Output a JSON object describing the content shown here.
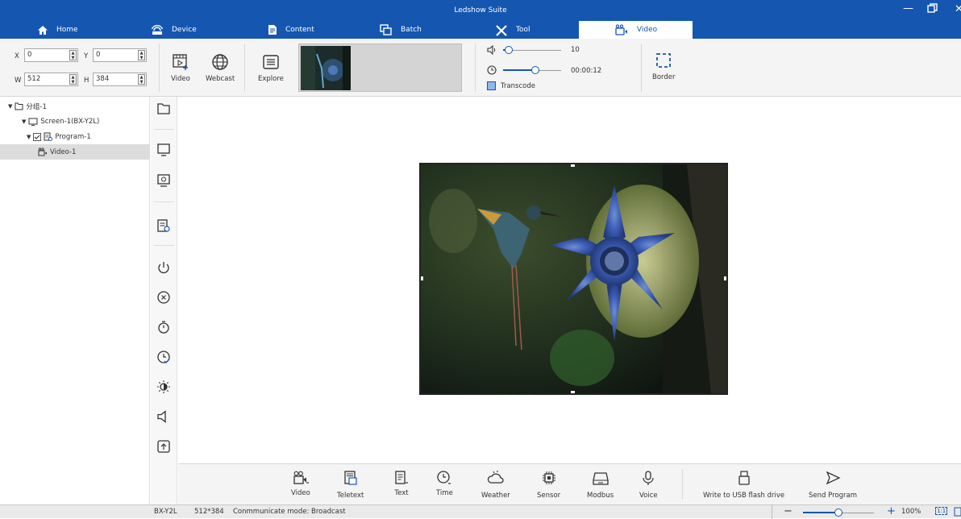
{
  "window": {
    "title": "Ledshow Suite",
    "controls": [
      "minimize-icon",
      "restore-icon",
      "close-icon"
    ]
  },
  "nav": {
    "tabs": [
      {
        "label": "Home",
        "icon": "home-icon"
      },
      {
        "label": "Device",
        "icon": "device-icon"
      },
      {
        "label": "Content",
        "icon": "content-icon"
      },
      {
        "label": "Batch",
        "icon": "batch-icon"
      },
      {
        "label": "Tool",
        "icon": "tool-icon"
      },
      {
        "label": "Video",
        "icon": "video-icon",
        "active": true
      }
    ]
  },
  "toolbar": {
    "x_label": "X",
    "x_value": "0",
    "y_label": "Y",
    "y_value": "0",
    "w_label": "W",
    "w_value": "512",
    "h_label": "H",
    "h_value": "384",
    "video_label": "Video",
    "webcast_label": "Webcast",
    "explore_label": "Explore",
    "volume_value": "10",
    "duration_value": "00:00:12",
    "transcode_label": "Transcode",
    "border_label": "Border",
    "volume_level": 0.1,
    "duration_level": 0.55
  },
  "tree": {
    "group": "分组-1",
    "screen": "Screen-1(BX-Y2L)",
    "program": "Program-1",
    "video": "Video-1"
  },
  "side_icons": [
    "folder-icon",
    "screen-icon",
    "screen-preview-icon",
    "program-list-icon",
    "power-icon",
    "cancel-icon",
    "timer-icon",
    "clock-check-icon",
    "brightness-icon",
    "volume-icon",
    "upload-icon"
  ],
  "bottom_toolbar": {
    "items": [
      {
        "label": "Video",
        "icon": "video-add-icon"
      },
      {
        "label": "Teletext",
        "icon": "teletext-icon"
      },
      {
        "label": "Text",
        "icon": "text-icon"
      },
      {
        "label": "Time",
        "icon": "time-icon"
      },
      {
        "label": "Weather",
        "icon": "weather-icon"
      },
      {
        "label": "Sensor",
        "icon": "sensor-icon"
      },
      {
        "label": "Modbus",
        "icon": "modbus-icon"
      },
      {
        "label": "Voice",
        "icon": "voice-icon"
      }
    ],
    "usb_label": "Write to USB flash drive",
    "send_label": "Send Program"
  },
  "status": {
    "model": "BX-Y2L",
    "resolution": "512*384",
    "mode": "Conmmunicate mode: Broadcast",
    "zoom": "100%",
    "zoom_minus": "−",
    "zoom_plus": "+",
    "fit_label": "1:1",
    "zoom_level": 0.5
  },
  "colors": {
    "accent": "#1556b0",
    "toolbar_bg": "#f4f4f4",
    "selected_row": "#dcdcdc"
  }
}
